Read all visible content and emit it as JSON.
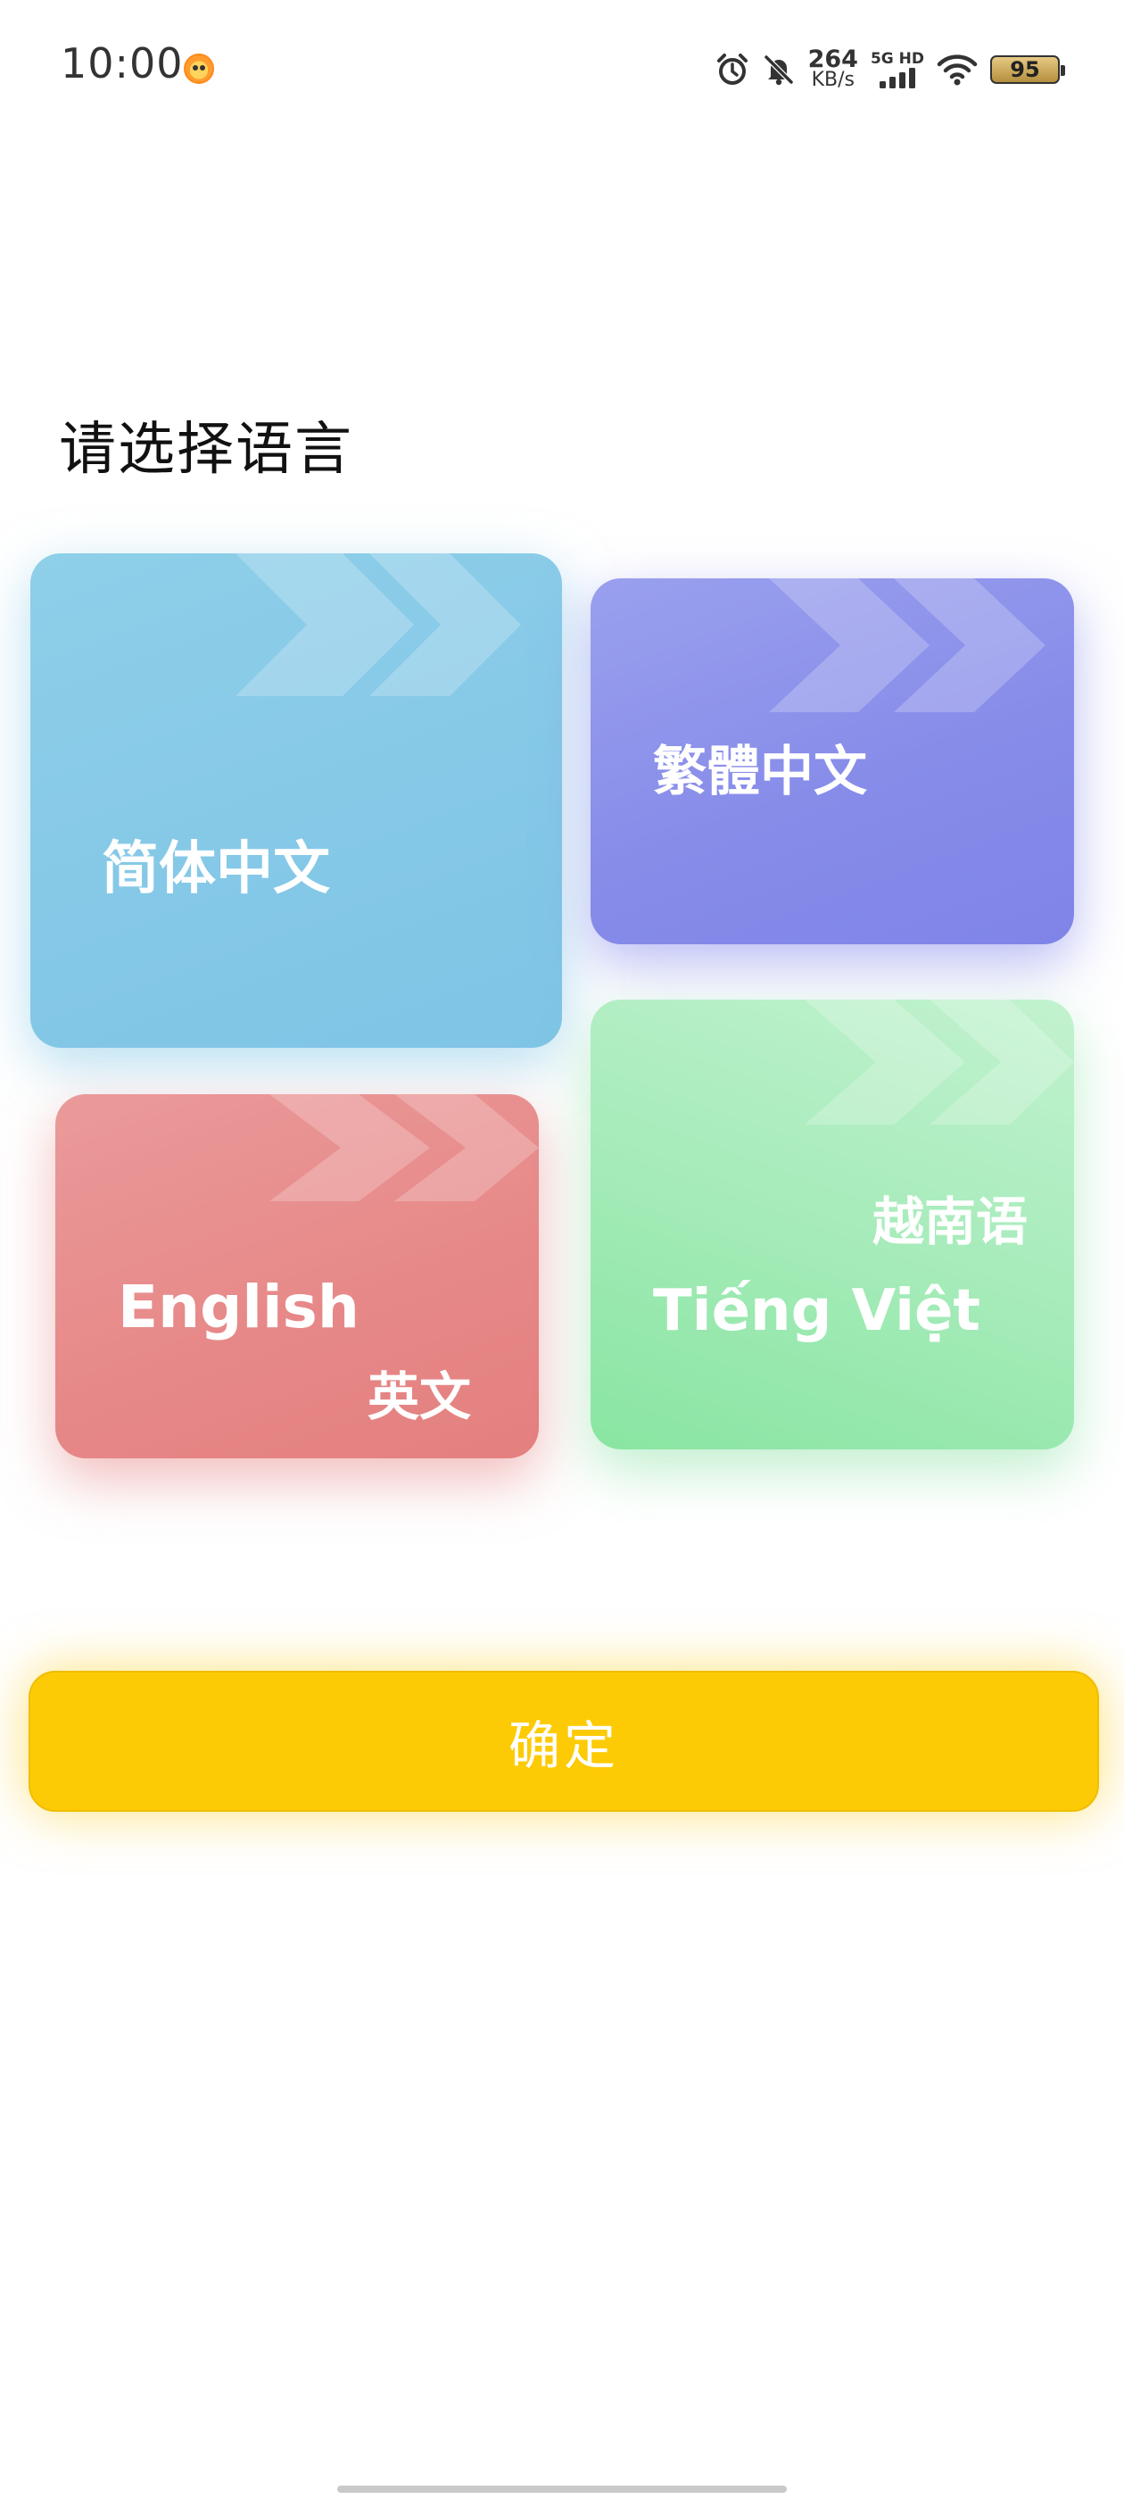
{
  "status_bar": {
    "time": "10:00",
    "net_speed_value": "264",
    "net_speed_unit": "KB/s",
    "signal_label": "5G HD",
    "battery_level": "95",
    "icons": [
      "alarm-icon",
      "bell-muted-icon",
      "cellular-signal-icon",
      "wifi-icon",
      "battery-icon"
    ]
  },
  "page": {
    "title": "请选择语言"
  },
  "languages": [
    {
      "id": "zh-hans",
      "labels": [
        "简体中文"
      ],
      "color": "#86c9e7"
    },
    {
      "id": "zh-hant",
      "labels": [
        "繁體中文"
      ],
      "color": "#878ce9"
    },
    {
      "id": "en",
      "labels": [
        "English",
        "英文"
      ],
      "color": "#e78989"
    },
    {
      "id": "vi",
      "labels": [
        "越南语",
        "Tiếng Việt"
      ],
      "color": "#a9ecbc"
    }
  ],
  "confirm_button": {
    "label": "确定",
    "color": "#fdcb05"
  }
}
